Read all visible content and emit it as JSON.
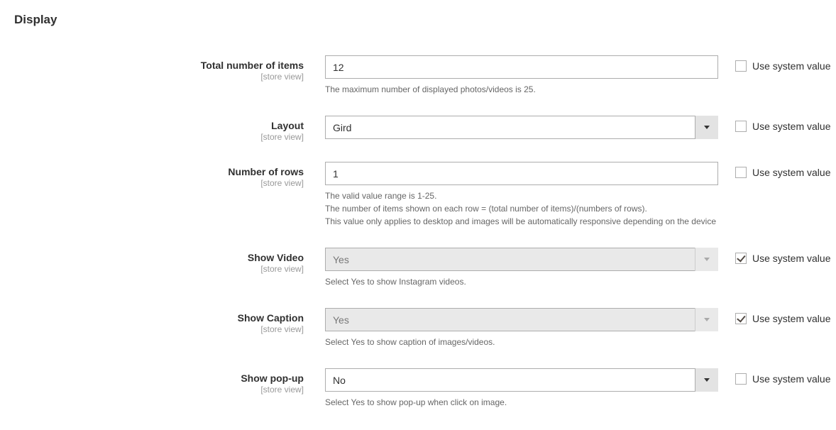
{
  "section_title": "Display",
  "scope_text": "[store view]",
  "use_system_label": "Use system value",
  "fields": {
    "total_items": {
      "label": "Total number of items",
      "value": "12",
      "note": "The maximum number of displayed photos/videos is 25.",
      "use_system": false
    },
    "layout": {
      "label": "Layout",
      "value": "Gird",
      "use_system": false
    },
    "rows": {
      "label": "Number of rows",
      "value": "1",
      "note": "The valid value range is 1-25.\nThe number of items shown on each row = (total number of items)/(numbers of rows).\nThis value only applies to desktop and images will be automatically responsive depending on the device",
      "use_system": false
    },
    "show_video": {
      "label": "Show Video",
      "value": "Yes",
      "note": "Select Yes to show Instagram videos.",
      "use_system": true
    },
    "show_caption": {
      "label": "Show Caption",
      "value": "Yes",
      "note": "Select Yes to show caption of images/videos.",
      "use_system": true
    },
    "show_popup": {
      "label": "Show pop-up",
      "value": "No",
      "note": "Select Yes to show pop-up when click on image.",
      "use_system": false
    }
  }
}
